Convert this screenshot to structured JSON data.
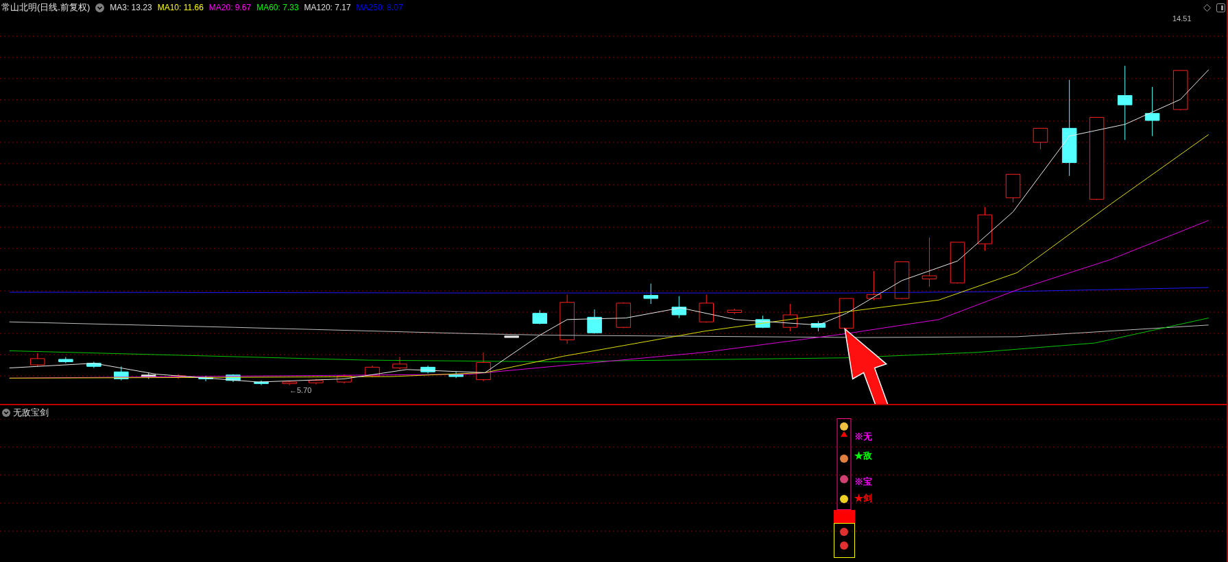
{
  "header": {
    "title": "常山北明(日线.前复权)",
    "averages": [
      {
        "label": "MA3: 13.23",
        "color": "#e0e0e0"
      },
      {
        "label": "MA10: 11.66",
        "color": "#ffff00"
      },
      {
        "label": "MA20: 9.67",
        "color": "#ff00ff"
      },
      {
        "label": "MA60: 7.33",
        "color": "#00ff00"
      },
      {
        "label": "MA120: 7.17",
        "color": "#e0e0e0"
      },
      {
        "label": "MA250: 8.07",
        "color": "#0000ff"
      }
    ]
  },
  "price_labels": {
    "high": "14.51",
    "low": "←5.70"
  },
  "indicator": {
    "title": "无敌宝剑",
    "signals": [
      {
        "text": "※无",
        "color": "#ff00ff"
      },
      {
        "text": "★敌",
        "color": "#00ff00"
      },
      {
        "text": "※宝",
        "color": "#ff00ff"
      },
      {
        "text": "★剑",
        "color": "#ff0000"
      }
    ]
  }
}
